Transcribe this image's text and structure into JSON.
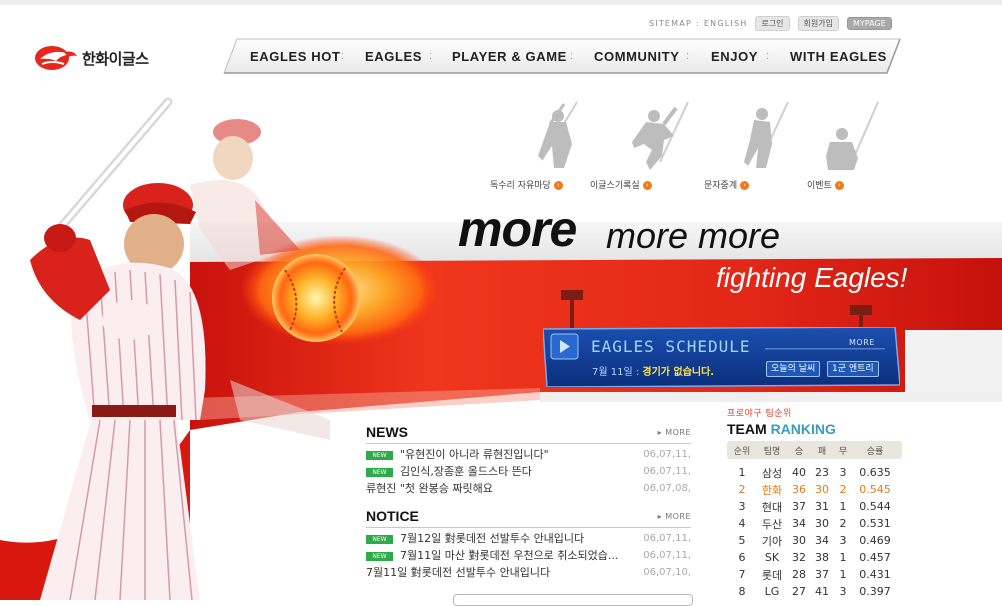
{
  "utility": {
    "sitemap": "SITEMAP",
    "separator": ":",
    "english": "ENGLISH",
    "login": "로그인",
    "join": "회원가입",
    "mypage": "MYPAGE"
  },
  "logo": {
    "text": "한화이글스",
    "brand_color": "#e8261c"
  },
  "nav": {
    "items": [
      "EAGLES HOT",
      "EAGLES",
      "PLAYER & GAME",
      "COMMUNITY",
      "ENJOY",
      "WITH EAGLES"
    ],
    "separator": ":"
  },
  "hero": {
    "icons": [
      {
        "label": "독수리 자유마당",
        "icon": "batter-silhouette-icon"
      },
      {
        "label": "이글스기록실",
        "icon": "pitcher-silhouette-icon"
      },
      {
        "label": "문자중계",
        "icon": "runner-silhouette-icon"
      },
      {
        "label": "이벤트",
        "icon": "catcher-silhouette-icon"
      }
    ],
    "more_big": "more",
    "more_small": "more more",
    "tagline": "fighting Eagles!",
    "accent_red": "#e3211a"
  },
  "schedule": {
    "title": "EAGLES SCHEDULE",
    "more": "MORE",
    "date": "7월 11일 :",
    "status": "경기가 없습니다.",
    "weather_button": "오늘의 날씨",
    "entry_button": "1군 엔트리"
  },
  "news": {
    "title": "NEWS",
    "more": "MORE",
    "items": [
      {
        "is_new": true,
        "new_label": "NEW",
        "text": "\"유현진이 아니라 류현진입니다\"",
        "date": "06,07,11,"
      },
      {
        "is_new": true,
        "new_label": "NEW",
        "text": "김인식,장종훈 올드스타 뜬다",
        "date": "06,07,11,"
      },
      {
        "is_new": false,
        "new_label": "",
        "text": "류현진 \"첫 완봉승 짜릿해요",
        "date": "06,07,08,"
      }
    ]
  },
  "notice": {
    "title": "NOTICE",
    "more": "MORE",
    "items": [
      {
        "is_new": true,
        "new_label": "NEW",
        "text": "7월12일 對롯데전 선발투수 안내입니다",
        "date": "06,07,11,"
      },
      {
        "is_new": true,
        "new_label": "NEW",
        "text": "7월11일 마산 對롯데전 우천으로 취소되었습...",
        "date": "06,07,11,"
      },
      {
        "is_new": false,
        "new_label": "",
        "text": "7월11일 對롯데전 선발투수 안내입니다",
        "date": "06,07,10,"
      }
    ]
  },
  "ranking": {
    "subtitle": "프로야구 팀순위",
    "title_a": "TEAM",
    "title_b": "RANKING",
    "headers": [
      "순위",
      "팀명",
      "승",
      "패",
      "무",
      "승률"
    ],
    "rows": [
      [
        "1",
        "삼성",
        "40",
        "23",
        "3",
        "0.635"
      ],
      [
        "2",
        "한화",
        "36",
        "30",
        "2",
        "0.545"
      ],
      [
        "3",
        "현대",
        "37",
        "31",
        "1",
        "0.544"
      ],
      [
        "4",
        "두산",
        "34",
        "30",
        "2",
        "0.531"
      ],
      [
        "5",
        "기아",
        "30",
        "34",
        "3",
        "0.469"
      ],
      [
        "6",
        "SK",
        "32",
        "38",
        "1",
        "0.457"
      ],
      [
        "7",
        "롯데",
        "28",
        "37",
        "1",
        "0.431"
      ],
      [
        "8",
        "LG",
        "27",
        "41",
        "3",
        "0.397"
      ]
    ],
    "highlight_team": "한화",
    "highlight_color": "#e47b1c"
  }
}
